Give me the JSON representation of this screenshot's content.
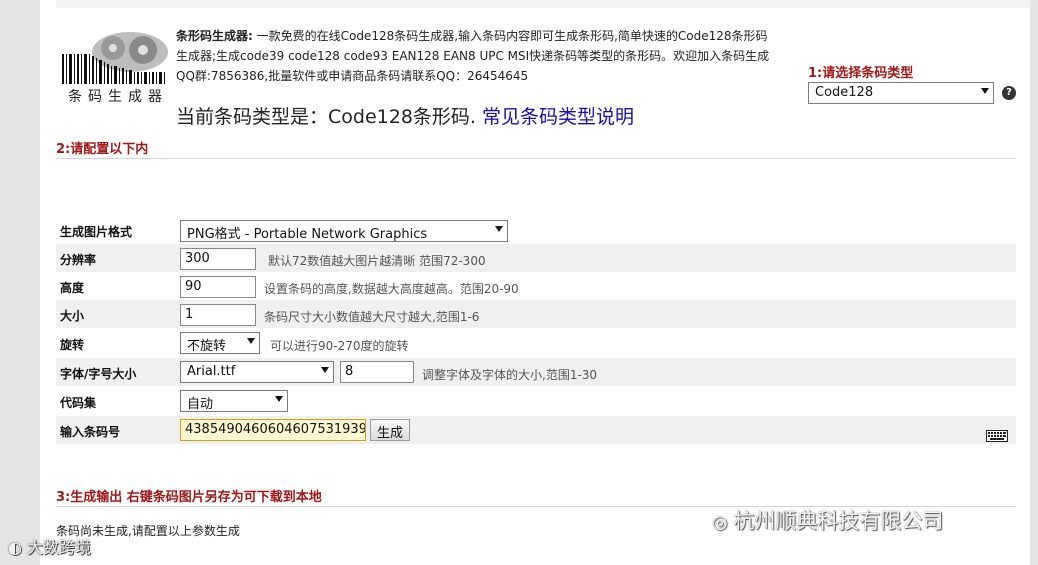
{
  "logo": {
    "caption": "条码生成器"
  },
  "intro": {
    "title": "条形码生成器:",
    "text": "一款免费的在线Code128条码生成器,输入条码内容即可生成条形码,简单快速的Code128条形码生成器;生成code39 code128 code93 EAN128 EAN8 UPC MSI快递条码等类型的条形码。欢迎加入条码生成 QQ群:7856386,批量软件或申请商品条码请联系QQ：26454645"
  },
  "current_type": {
    "prefix": "当前条码类型是：Code128条形码.",
    "link": "常见条码类型说明"
  },
  "step1": {
    "label": "1:请选择条码类型",
    "selected": "Code128",
    "help": "?"
  },
  "step2": {
    "label": "2:请配置以下内"
  },
  "form": {
    "format": {
      "label": "生成图片格式",
      "value": "PNG格式 - Portable Network Graphics"
    },
    "resolution": {
      "label": "分辨率",
      "value": "300",
      "hint": "默认72数值越大图片越清晰 范围72-300"
    },
    "height": {
      "label": "高度",
      "value": "90",
      "hint": "设置条码的高度,数据越大高度越高。范围20-90"
    },
    "size": {
      "label": "大小",
      "value": "1",
      "hint": "条码尺寸大小数值越大尺寸越大,范围1-6"
    },
    "rotate": {
      "label": "旋转",
      "value": "不旋转",
      "hint": "可以进行90-270度的旋转"
    },
    "font": {
      "label": "字体/字号大小",
      "value": "Arial.ttf",
      "size": "8",
      "hint": "调整字体及字体的大小,范围1-30"
    },
    "charset": {
      "label": "代码集",
      "value": "自动"
    },
    "code": {
      "label": "输入条码号",
      "value": "4385490460604607531939",
      "button": "生成"
    }
  },
  "step3": {
    "label": "3:生成输出 右键条码图片另存为可下载到本地"
  },
  "status": {
    "text": "条码尚未生成,请配置以上参数生成"
  },
  "watermarks": {
    "company": "杭州顺典科技有限公司",
    "brand": "大数跨境"
  },
  "colors": {
    "section_red": "#a01818",
    "link_blue": "#1a0dab",
    "row_alt": "#f0f0f0"
  }
}
